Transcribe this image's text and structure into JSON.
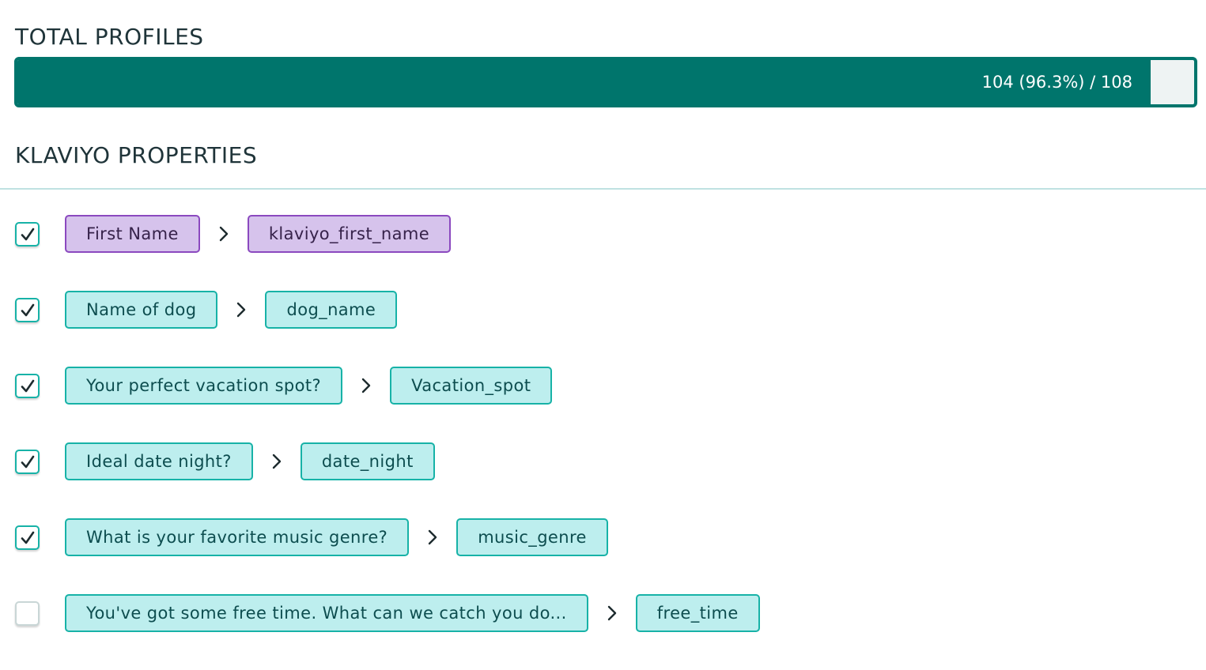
{
  "total_profiles": {
    "title": "TOTAL PROFILES",
    "count": 104,
    "total": 108,
    "fraction": 0.963,
    "label": "104 (96.3%) / 108"
  },
  "klaviyo": {
    "title": "KLAVIYO PROPERTIES",
    "rows": [
      {
        "checked": true,
        "source": "First Name",
        "target": "klaviyo_first_name",
        "style": "purple"
      },
      {
        "checked": true,
        "source": "Name of dog",
        "target": "dog_name",
        "style": "teal"
      },
      {
        "checked": true,
        "source": "Your perfect vacation spot?",
        "target": "Vacation_spot",
        "style": "teal"
      },
      {
        "checked": true,
        "source": "Ideal date night?",
        "target": "date_night",
        "style": "teal"
      },
      {
        "checked": true,
        "source": "What is your favorite music genre?",
        "target": "music_genre",
        "style": "teal"
      },
      {
        "checked": false,
        "source": "You've got some free time. What can we catch you do...",
        "target": "free_time",
        "style": "teal"
      }
    ]
  },
  "colors": {
    "bar_fill": "#00756c",
    "teal_tag_bg": "#bdeeee",
    "teal_tag_border": "#17b2a7",
    "purple_tag_bg": "#d6c3ec",
    "purple_tag_border": "#8b49bf"
  },
  "icons": {
    "check": "check-icon",
    "arrow": "chevron-right-icon"
  }
}
